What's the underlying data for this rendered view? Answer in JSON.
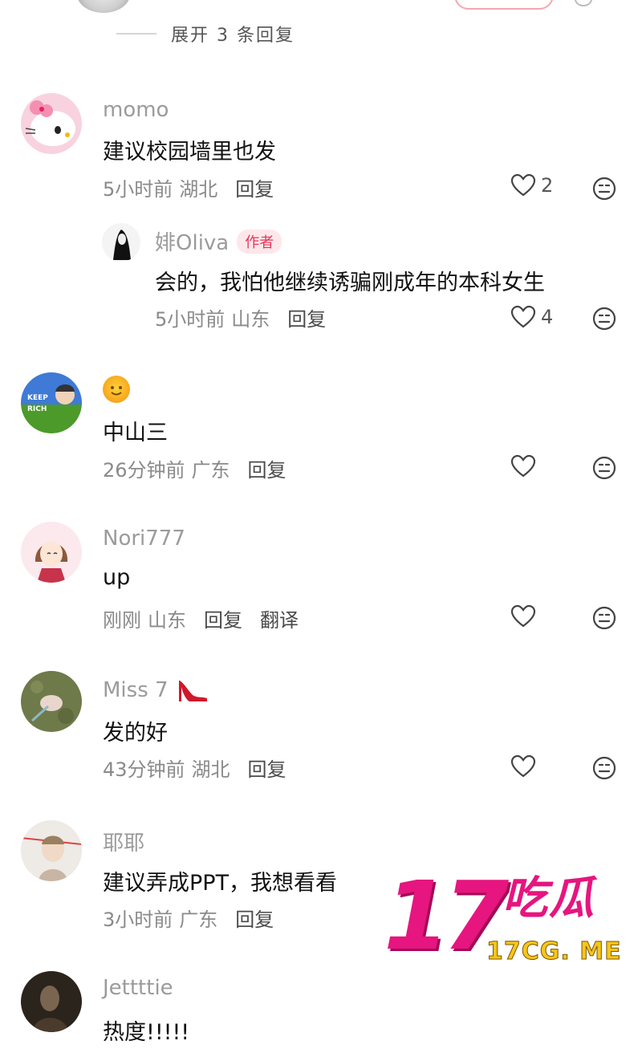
{
  "expand": {
    "label": "展开 3 条回复"
  },
  "comments": [
    {
      "username": "momo",
      "text": "建议校园墙里也发",
      "time": "5小时前",
      "location": "湖北",
      "reply_label": "回复",
      "likes": "2",
      "avatar_icon": "hello-kitty-avatar",
      "replies": [
        {
          "username": "婔Oliva",
          "badge": "作者",
          "text": "会的，我怕他继续诱骗刚成年的本科女生",
          "time": "5小时前",
          "location": "山东",
          "reply_label": "回复",
          "likes": "4"
        }
      ]
    },
    {
      "username_icon": "sun-emoji",
      "text": "中山三",
      "time": "26分钟前",
      "location": "广东",
      "reply_label": "回复",
      "likes": "",
      "avatar_text": "KEEP RICH"
    },
    {
      "username": "Nori777",
      "text": "up",
      "time": "刚刚",
      "location": "山东",
      "reply_label": "回复",
      "translate_label": "翻译",
      "likes": ""
    },
    {
      "username": "Miss 7",
      "username_icon": "high-heel-emoji",
      "text": "发的好",
      "time": "43分钟前",
      "location": "湖北",
      "reply_label": "回复",
      "likes": ""
    },
    {
      "username": "耶耶",
      "text": "建议弄成PPT，我想看看",
      "time": "3小时前",
      "location": "广东",
      "reply_label": "回复",
      "likes": ""
    },
    {
      "username": "Jettttie",
      "text": "热度!!!!!",
      "likes": ""
    }
  ],
  "watermark": {
    "big": "17",
    "brand": "吃瓜",
    "url": "17CG. ME"
  },
  "colors": {
    "accent": "#e6157f",
    "badge": "#e2365b",
    "url": "#f7c51d"
  }
}
